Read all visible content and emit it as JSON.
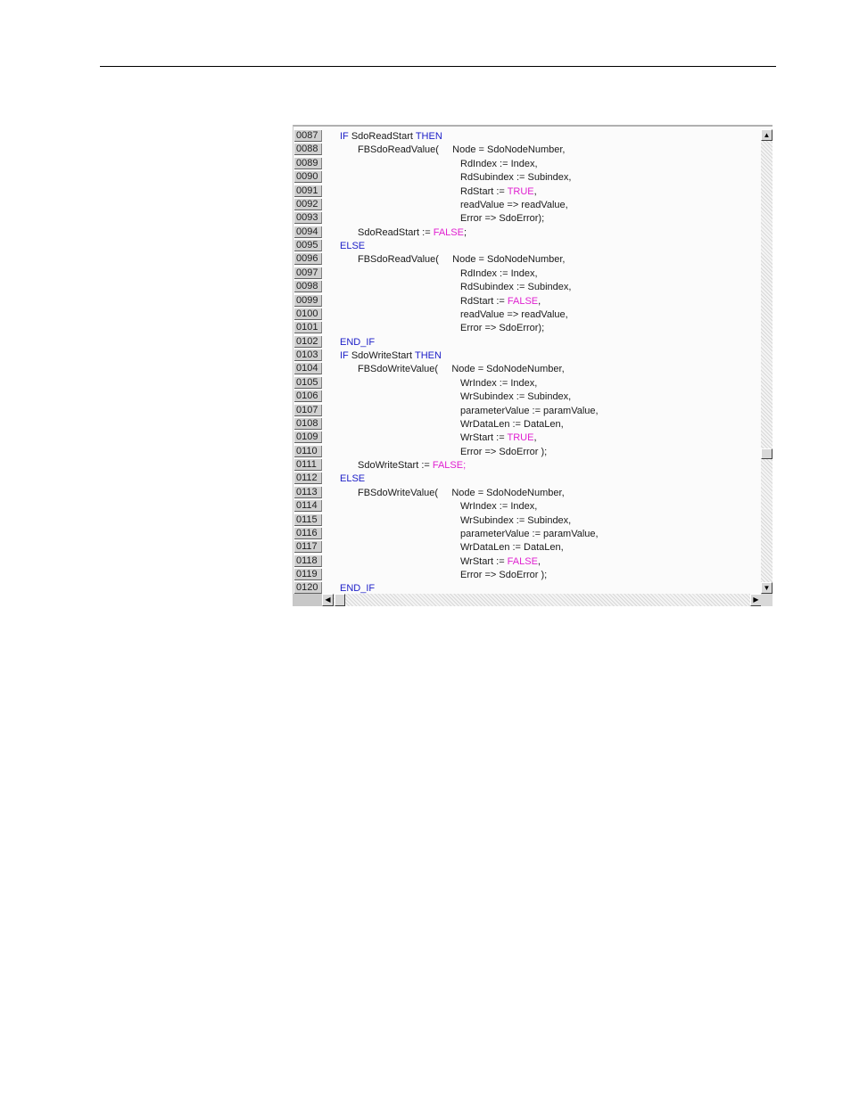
{
  "editor": {
    "scroll_up": "▲",
    "scroll_down": "▼",
    "scroll_left": "◀",
    "scroll_right": "▶",
    "lines": [
      {
        "num": "0087",
        "indent": 0,
        "parts": [
          [
            "kw",
            "IF "
          ],
          [
            "",
            "SdoReadStart "
          ],
          [
            "kw",
            "THEN"
          ]
        ]
      },
      {
        "num": "0088",
        "indent": 1,
        "parts": [
          [
            "",
            "FBSdoReadValue(     Node = SdoNodeNumber,"
          ]
        ]
      },
      {
        "num": "0089",
        "indent": 2,
        "parts": [
          [
            "",
            "RdIndex := Index,"
          ]
        ]
      },
      {
        "num": "0090",
        "indent": 2,
        "parts": [
          [
            "",
            "RdSubindex := Subindex,"
          ]
        ]
      },
      {
        "num": "0091",
        "indent": 2,
        "parts": [
          [
            "",
            "RdStart := "
          ],
          [
            "lit",
            "TRUE"
          ],
          [
            "",
            ","
          ]
        ]
      },
      {
        "num": "0092",
        "indent": 2,
        "parts": [
          [
            "",
            "readValue => readValue,"
          ]
        ]
      },
      {
        "num": "0093",
        "indent": 2,
        "parts": [
          [
            "",
            "Error => SdoError);"
          ]
        ]
      },
      {
        "num": "0094",
        "indent": 1,
        "parts": [
          [
            "",
            "SdoReadStart := "
          ],
          [
            "lit",
            "FALSE"
          ],
          [
            "",
            ";"
          ]
        ]
      },
      {
        "num": "0095",
        "indent": 0,
        "parts": [
          [
            "kw",
            "ELSE"
          ]
        ]
      },
      {
        "num": "0096",
        "indent": 1,
        "parts": [
          [
            "",
            "FBSdoReadValue(     Node = SdoNodeNumber,"
          ]
        ]
      },
      {
        "num": "0097",
        "indent": 2,
        "parts": [
          [
            "",
            "RdIndex := Index,"
          ]
        ]
      },
      {
        "num": "0098",
        "indent": 2,
        "parts": [
          [
            "",
            "RdSubindex := Subindex,"
          ]
        ]
      },
      {
        "num": "0099",
        "indent": 2,
        "parts": [
          [
            "",
            "RdStart := "
          ],
          [
            "lit",
            "FALSE"
          ],
          [
            "",
            ","
          ]
        ]
      },
      {
        "num": "0100",
        "indent": 2,
        "parts": [
          [
            "",
            "readValue => readValue,"
          ]
        ]
      },
      {
        "num": "0101",
        "indent": 2,
        "parts": [
          [
            "",
            "Error => SdoError);"
          ]
        ]
      },
      {
        "num": "0102",
        "indent": 0,
        "parts": [
          [
            "kw",
            "END_IF"
          ]
        ]
      },
      {
        "num": "0103",
        "indent": 0,
        "parts": [
          [
            "kw",
            "IF "
          ],
          [
            "",
            "SdoWriteStart "
          ],
          [
            "kw",
            "THEN"
          ]
        ]
      },
      {
        "num": "0104",
        "indent": 1,
        "parts": [
          [
            "",
            "FBSdoWriteValue(     Node = SdoNodeNumber,"
          ]
        ]
      },
      {
        "num": "0105",
        "indent": 2,
        "parts": [
          [
            "",
            "WrIndex := Index,"
          ]
        ]
      },
      {
        "num": "0106",
        "indent": 2,
        "parts": [
          [
            "",
            "WrSubindex := Subindex,"
          ]
        ]
      },
      {
        "num": "0107",
        "indent": 2,
        "parts": [
          [
            "",
            "parameterValue := paramValue,"
          ]
        ]
      },
      {
        "num": "0108",
        "indent": 2,
        "parts": [
          [
            "",
            "WrDataLen := DataLen,"
          ]
        ]
      },
      {
        "num": "0109",
        "indent": 2,
        "parts": [
          [
            "",
            "WrStart := "
          ],
          [
            "lit",
            "TRUE"
          ],
          [
            "",
            ","
          ]
        ]
      },
      {
        "num": "0110",
        "indent": 2,
        "parts": [
          [
            "",
            "Error => SdoError );"
          ]
        ]
      },
      {
        "num": "0111",
        "indent": 1,
        "parts": [
          [
            "",
            "SdoWriteStart := "
          ],
          [
            "lit",
            "FALSE;"
          ]
        ]
      },
      {
        "num": "0112",
        "indent": 0,
        "parts": [
          [
            "kw",
            "ELSE"
          ]
        ]
      },
      {
        "num": "0113",
        "indent": 1,
        "parts": [
          [
            "",
            "FBSdoWriteValue(     Node = SdoNodeNumber,"
          ]
        ]
      },
      {
        "num": "0114",
        "indent": 2,
        "parts": [
          [
            "",
            "WrIndex := Index,"
          ]
        ]
      },
      {
        "num": "0115",
        "indent": 2,
        "parts": [
          [
            "",
            "WrSubindex := Subindex,"
          ]
        ]
      },
      {
        "num": "0116",
        "indent": 2,
        "parts": [
          [
            "",
            "parameterValue := paramValue,"
          ]
        ]
      },
      {
        "num": "0117",
        "indent": 2,
        "parts": [
          [
            "",
            "WrDataLen := DataLen,"
          ]
        ]
      },
      {
        "num": "0118",
        "indent": 2,
        "parts": [
          [
            "",
            "WrStart := "
          ],
          [
            "lit",
            "FALSE"
          ],
          [
            "",
            ","
          ]
        ]
      },
      {
        "num": "0119",
        "indent": 2,
        "parts": [
          [
            "",
            "Error => SdoError );"
          ]
        ]
      },
      {
        "num": "0120",
        "indent": 0,
        "parts": [
          [
            "kw",
            "END_IF"
          ]
        ]
      }
    ]
  }
}
